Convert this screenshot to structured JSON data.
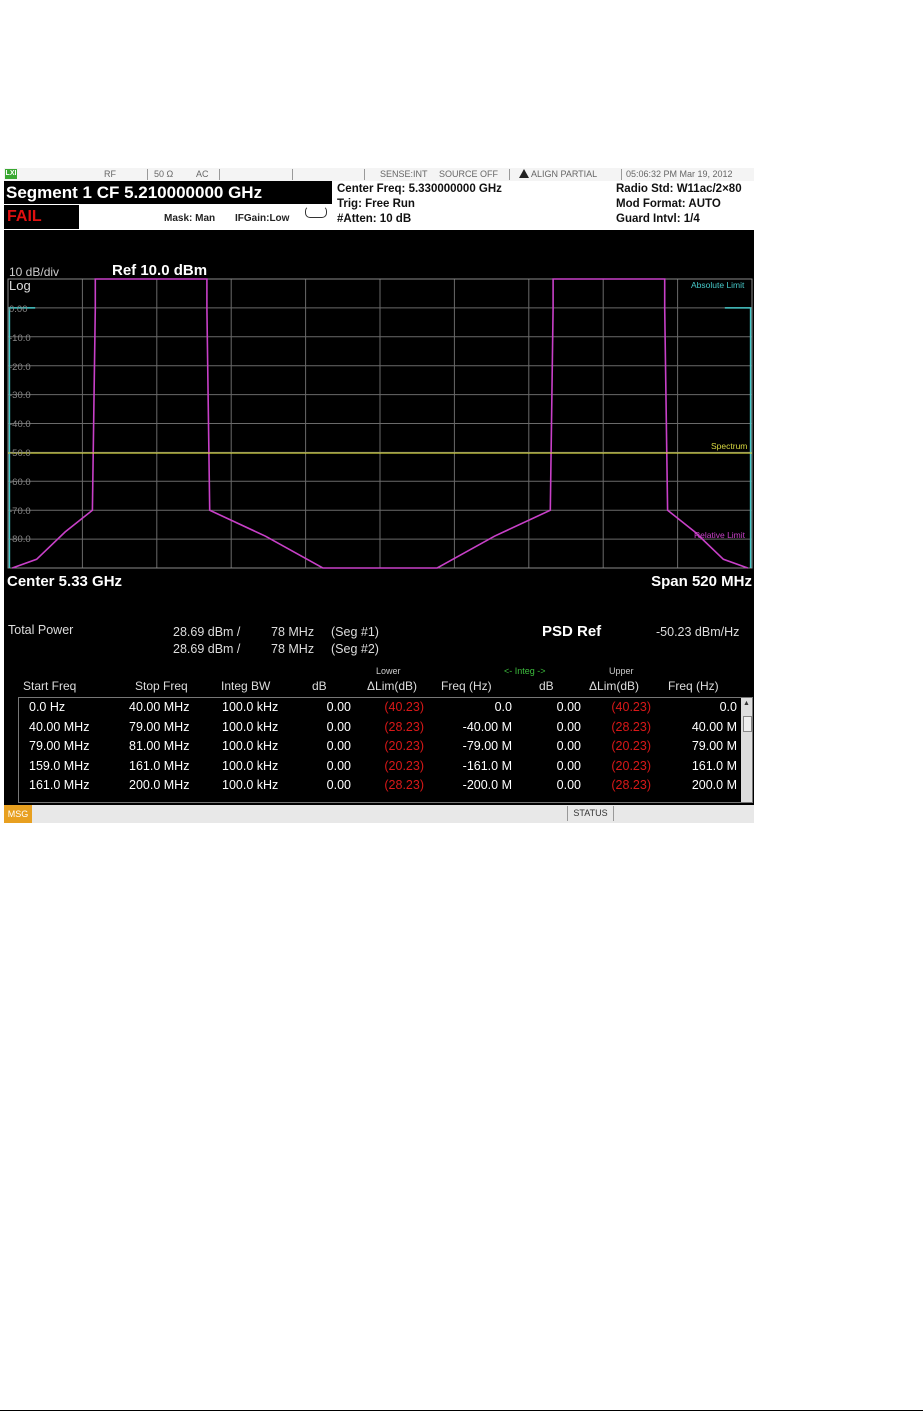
{
  "statusbar": {
    "lxi_label": "LXI",
    "rf": "RF",
    "impedance": "50 Ω",
    "coupling": "AC",
    "sense": "SENSE:INT",
    "source": "SOURCE OFF",
    "align": "ALIGN PARTIAL",
    "datetime": "05:06:32 PM Mar 19, 2012"
  },
  "header": {
    "segment_title": "Segment 1 CF 5.210000000 GHz",
    "fail": "FAIL",
    "mask": "Mask: Man",
    "ifgain": "IFGain:Low",
    "center_freq": "Center Freq: 5.330000000 GHz",
    "trig": "Trig: Free Run",
    "atten": "#Atten: 10 dB",
    "radio_std": "Radio Std: W11ac/2×80",
    "mod_format": "Mod Format: AUTO",
    "guard_intvl": "Guard Intvl: 1/4"
  },
  "plot": {
    "scale": "10 dB/div",
    "ref": "Ref 10.0 dBm",
    "log": "Log",
    "y_ticks": [
      "0.00",
      "-10.0",
      "-20.0",
      "-30.0",
      "-40.0",
      "-50.0",
      "-60.0",
      "-70.0",
      "-80.0"
    ],
    "labels": {
      "absolute_limit": "Absolute Limit",
      "spectrum": "Spectrum",
      "relative_limit": "Relative Limit"
    },
    "center": "Center  5.33 GHz",
    "span": "Span 520 MHz",
    "colors": {
      "absolute_limit": "#46c8c8",
      "spectrum": "#d8d840",
      "relative_limit": "#c840c8",
      "grid": "#6a6a6a"
    },
    "spectrum_level_dbm": -50.23
  },
  "results": {
    "total_power_label": "Total Power",
    "total_power": [
      {
        "power": "28.69 dBm /",
        "bw": "78 MHz",
        "seg": "(Seg #1)"
      },
      {
        "power": "28.69 dBm /",
        "bw": "78 MHz",
        "seg": "(Seg #2)"
      }
    ],
    "psd_ref_label": "PSD Ref",
    "psd_ref_value": "-50.23 dBm/Hz",
    "group_lower": "Lower",
    "group_upper": "Upper",
    "group_integ": "<- Integ ->",
    "columns": [
      "Start Freq",
      "Stop Freq",
      "Integ BW",
      "dB",
      "ΔLim(dB)",
      "Freq (Hz)",
      "dB",
      "ΔLim(dB)",
      "Freq (Hz)"
    ],
    "rows": [
      [
        "0.0 Hz",
        "40.00 MHz",
        "100.0 kHz",
        "0.00",
        "(40.23)",
        "0.0",
        "0.00",
        "(40.23)",
        "0.0"
      ],
      [
        "40.00 MHz",
        "79.00 MHz",
        "100.0 kHz",
        "0.00",
        "(28.23)",
        "-40.00 M",
        "0.00",
        "(28.23)",
        "40.00 M"
      ],
      [
        "79.00 MHz",
        "81.00 MHz",
        "100.0 kHz",
        "0.00",
        "(20.23)",
        "-79.00 M",
        "0.00",
        "(20.23)",
        "79.00 M"
      ],
      [
        "159.0 MHz",
        "161.0 MHz",
        "100.0 kHz",
        "0.00",
        "(20.23)",
        "-161.0 M",
        "0.00",
        "(20.23)",
        "161.0 M"
      ],
      [
        "161.0 MHz",
        "200.0 MHz",
        "100.0 kHz",
        "0.00",
        "(28.23)",
        "-200.0 M",
        "0.00",
        "(28.23)",
        "200.0 M"
      ]
    ],
    "colors": {
      "fail_value": "#d81818"
    }
  },
  "bottombar": {
    "msg": "MSG",
    "status": "STATUS"
  }
}
